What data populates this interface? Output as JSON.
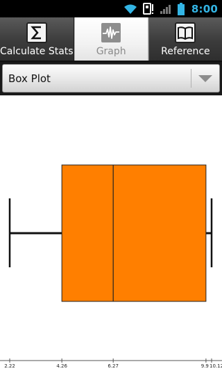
{
  "status_bar": {
    "time": "8:00",
    "icons": [
      "wifi-icon",
      "sim-alert-icon",
      "signal-icon",
      "battery-icon"
    ],
    "time_color": "#33b5e5"
  },
  "tabs": [
    {
      "label": "Calculate Stats",
      "icon": "sigma-icon",
      "selected": false
    },
    {
      "label": "Graph",
      "icon": "waveform-icon",
      "selected": true
    },
    {
      "label": "Reference",
      "icon": "book-icon",
      "selected": false
    }
  ],
  "chart_selector": {
    "value": "Box Plot",
    "icon": "chevron-down-icon"
  },
  "chart_data": {
    "type": "box",
    "min": 2.22,
    "q1": 4.26,
    "median": 6.27,
    "q3": 9.9,
    "max": 10.12,
    "tick_labels": [
      "2.22",
      "4.26",
      "6.27",
      "9.9",
      "10.12"
    ],
    "box_color": "#ff7f00"
  }
}
